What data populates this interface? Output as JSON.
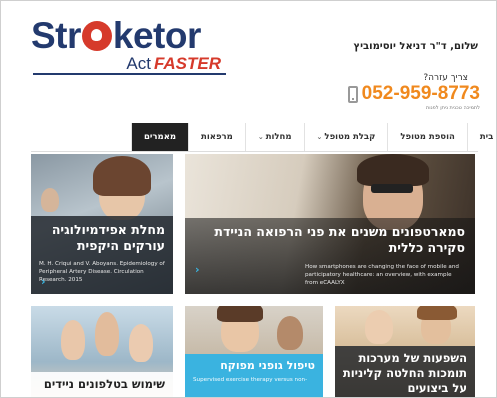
{
  "header": {
    "logo_main": "Str",
    "logo_tail": "ketor",
    "logo_sub": "Act",
    "logo_sub_accent": "FASTER",
    "greeting": "שלום, ד\"ר דניאל יוסימוביץ",
    "need_help": "צריך עזרה?",
    "phone": "052-959-8773",
    "phone_note": "לתמיכה טכנית ניתן לפנות"
  },
  "nav": {
    "items": [
      {
        "label": "בית",
        "dropdown": false,
        "active": false
      },
      {
        "label": "הוספת מטופל",
        "dropdown": false,
        "active": false
      },
      {
        "label": "קבלת מטופל",
        "dropdown": true,
        "active": false
      },
      {
        "label": "מחלות",
        "dropdown": true,
        "active": false
      },
      {
        "label": "מרפאות",
        "dropdown": false,
        "active": false
      },
      {
        "label": "מאמרים",
        "dropdown": false,
        "active": true
      }
    ]
  },
  "articles": [
    {
      "title": "מחלת אפידמיולוגיה עורקים היקפית",
      "excerpt": "M. H. Criqui and V. Aboyans. Epidemiology of Peripheral Artery Disease. Circulation Research. 2015"
    },
    {
      "title": "סמארטפונים משנים את פני הרפואה הניידת סקירה כללית",
      "excerpt": "How smartphones are changing the face of mobile and participatory healthcare: an overview, with example from eCAALYX"
    },
    {
      "title": "שימוש בטלפונים ניידים"
    },
    {
      "title": "טיפול גופני מפוקח",
      "excerpt": "Supervised exercise therapy versus non-"
    },
    {
      "title": "השפעות של מערכות תומכות החלטה קליניות על ביצועים"
    }
  ],
  "colors": {
    "brand_navy": "#233a6e",
    "brand_red": "#d63a2b",
    "phone_orange": "#f0891e",
    "accent_blue": "#3ab7e4",
    "nav_active_bg": "#222222"
  },
  "icons": {
    "phone": "mobile-phone-icon",
    "chevron": "chevron-down-icon",
    "read_more": "chevron-right-icon"
  }
}
